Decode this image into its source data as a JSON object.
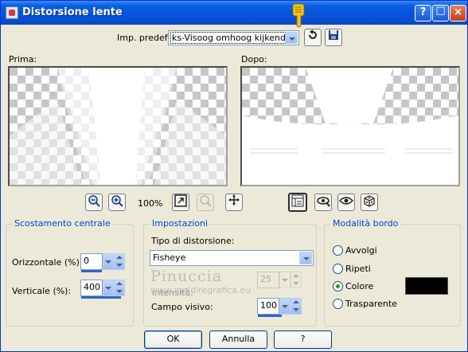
{
  "window": {
    "title": "Distorsione lente"
  },
  "titlebar_buttons": {
    "help": "?",
    "minimize": "_",
    "maximize": "□",
    "close": "×"
  },
  "preset": {
    "label": "Imp. predef.:",
    "value": "ks-Visoog omhoog kijkend"
  },
  "preview": {
    "before_label": "Prima:",
    "after_label": "Dopo:",
    "zoom": "100%"
  },
  "center_offset": {
    "title": "Scostamento centrale",
    "horizontal_label": "Orizzontale (%):",
    "horizontal_value": "0",
    "vertical_label": "Verticale (%):",
    "vertical_value": "400"
  },
  "settings": {
    "title": "Impostazioni",
    "distortion_type_label": "Tipo di distorsione:",
    "distortion_type_value": "Fisheye",
    "intensity_label": "Intensità:",
    "intensity_value": "25",
    "field_of_view_label": "Campo visivo:",
    "field_of_view_value": "100"
  },
  "edge_mode": {
    "title": "Modalità bordo",
    "options": [
      {
        "label": "Avvolgi",
        "selected": false
      },
      {
        "label": "Ripeti",
        "selected": false
      },
      {
        "label": "Colore",
        "selected": true
      },
      {
        "label": "Trasparente",
        "selected": false
      }
    ],
    "color": "#000000"
  },
  "watermark": {
    "line1": "Pinuccia",
    "line2": "www.maidiregrafica.eu"
  },
  "footer": {
    "ok": "OK",
    "cancel": "Annulla",
    "help": "?"
  },
  "icons": [
    "zoom-out-icon",
    "zoom-in-icon",
    "fit-window-icon",
    "zoom-disabled-icon",
    "pan-icon",
    "toggle-preview-icon",
    "proof-icon",
    "eye-icon",
    "randomize-icon",
    "reset-icon",
    "save-preset-icon",
    "pointing-hand-icon"
  ]
}
